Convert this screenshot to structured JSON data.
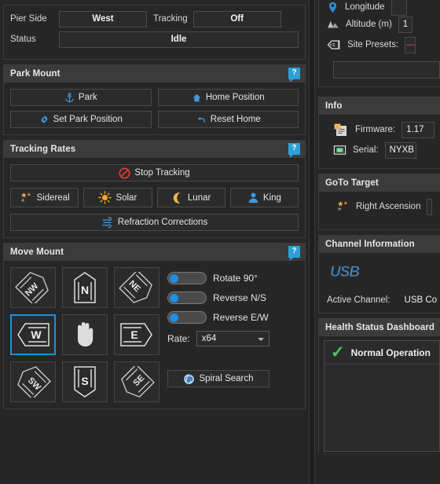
{
  "theme": {
    "bg": "#262626",
    "panel_bg": "#2b2b2b",
    "header_bg": "#3b3b3b",
    "accent": "#1d8fe0",
    "help_badge": "#2e9fd8",
    "ok_green": "#4cc764",
    "star_orange": "#e8a33d",
    "stop_red": "#e03c3c"
  },
  "left_panel": {
    "status": {
      "pier_side_label": "Pier Side",
      "pier_side_value": "West",
      "tracking_label": "Tracking",
      "tracking_value": "Off",
      "status_label": "Status",
      "status_value": "Idle"
    },
    "park_mount": {
      "title": "Park Mount",
      "help": "?",
      "buttons": [
        {
          "label": "Park",
          "icon": "anchor-icon"
        },
        {
          "label": "Home Position",
          "icon": "home-icon"
        },
        {
          "label": "Set Park Position",
          "icon": "gear-icon"
        },
        {
          "label": "Reset Home",
          "icon": "undo-arrow-icon"
        }
      ]
    },
    "tracking_rates": {
      "title": "Tracking Rates",
      "help": "?",
      "stop_button": {
        "label": "Stop Tracking",
        "icon": "stop-sign-icon"
      },
      "rate_buttons": [
        {
          "label": "Sidereal",
          "icon": "stars-icon"
        },
        {
          "label": "Solar",
          "icon": "sun-icon"
        },
        {
          "label": "Lunar",
          "icon": "moon-icon"
        },
        {
          "label": "King",
          "icon": "person-icon"
        }
      ],
      "refraction_button": {
        "label": "Refraction Corrections",
        "icon": "wind-icon"
      }
    },
    "move_mount": {
      "title": "Move Mount",
      "help": "?",
      "dpad": [
        {
          "label": "NW",
          "name": "move-northwest",
          "selected": false,
          "shape": "diag"
        },
        {
          "label": "N",
          "name": "move-north",
          "selected": false,
          "shape": "vert"
        },
        {
          "label": "NE",
          "name": "move-northeast",
          "selected": false,
          "shape": "diag"
        },
        {
          "label": "W",
          "name": "move-west",
          "selected": true,
          "shape": "horz"
        },
        {
          "label": "",
          "name": "move-stop",
          "selected": false,
          "shape": "hand"
        },
        {
          "label": "E",
          "name": "move-east",
          "selected": false,
          "shape": "horz"
        },
        {
          "label": "SW",
          "name": "move-southwest",
          "selected": false,
          "shape": "diag"
        },
        {
          "label": "S",
          "name": "move-south",
          "selected": false,
          "shape": "vert"
        },
        {
          "label": "SE",
          "name": "move-southeast",
          "selected": false,
          "shape": "diag"
        }
      ],
      "toggles": [
        {
          "label": "Rotate 90°",
          "on": false
        },
        {
          "label": "Reverse N/S",
          "on": false
        },
        {
          "label": "Reverse E/W",
          "on": false
        }
      ],
      "rate": {
        "label": "Rate:",
        "value": "x64"
      },
      "spiral_button": {
        "label": "Spiral Search",
        "icon": "spiral-icon"
      }
    }
  },
  "right_panel": {
    "site": {
      "longitude_label": "Longitude",
      "altitude_label": "Altitude (m)",
      "altitude_value": "1",
      "site_presets_label": "Site Presets:",
      "site_presets_value": "—"
    },
    "info": {
      "title": "Info",
      "firmware_label": "Firmware:",
      "firmware_value": "1.17",
      "serial_label": "Serial:",
      "serial_value": "NYXB"
    },
    "goto_target": {
      "title": "GoTo Target",
      "right_ascension_label": "Right Ascension",
      "icon": "stars-icon"
    },
    "channel_information": {
      "title": "Channel Information",
      "logo": "USB",
      "active_channel_label": "Active Channel:",
      "active_channel_value": "USB Co"
    },
    "health_status": {
      "title": "Health Status Dashboard",
      "rows": [
        {
          "icon": "check-icon",
          "text": "Normal Operation"
        }
      ]
    }
  }
}
